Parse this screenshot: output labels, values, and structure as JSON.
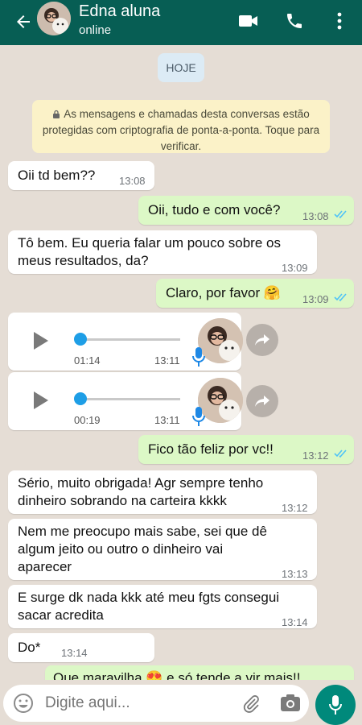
{
  "header": {
    "contact_name": "Edna aluna",
    "status": "online",
    "icons": [
      "back-arrow-icon",
      "avatar",
      "video-call-icon",
      "phone-icon",
      "menu-dots-icon"
    ]
  },
  "chat": {
    "date_chip": "HOJE",
    "security_notice": "As mensagens e chamadas desta conversas estão protegidas com criptografia de ponta-a-ponta. Toque para verificar.",
    "messages": [
      {
        "direction": "in",
        "text": "Oii td bem??",
        "time": "13:08"
      },
      {
        "direction": "out",
        "text": "Oii, tudo e com você?",
        "time": "13:08",
        "read": true
      },
      {
        "direction": "in",
        "text": "Tô bem. Eu queria falar um pouco sobre os meus resultados, da?",
        "time": "13:09"
      },
      {
        "direction": "out",
        "text": "Claro, por favor 🤗",
        "time": "13:09",
        "read": true
      },
      {
        "direction": "in",
        "type": "audio",
        "duration": "01:14",
        "time": "13:11"
      },
      {
        "direction": "in",
        "type": "audio",
        "duration": "00:19",
        "time": "13:11"
      },
      {
        "direction": "out",
        "text": "Fico tão feliz por vc!!",
        "time": "13:12",
        "read": true
      },
      {
        "direction": "in",
        "text": "Sério, muito obrigada! Agr sempre tenho dinheiro sobrando na carteira kkkk",
        "time": "13:12"
      },
      {
        "direction": "in",
        "text": "Nem me preocupo mais sabe, sei que dê algum jeito ou outro o dinheiro vai aparecer",
        "time": "13:13"
      },
      {
        "direction": "in",
        "text": "E surge dk nada kkk até meu fgts consegui sacar acredita",
        "time": "13:14"
      },
      {
        "direction": "in",
        "text": "Do*",
        "time": "13:14"
      },
      {
        "direction": "out",
        "text": "Que maravilha 😍 e só tende a vir mais!!",
        "time": ""
      }
    ]
  },
  "composer": {
    "placeholder": "Digite aqui..."
  },
  "colors": {
    "header": "#075e54",
    "chat_bg": "#e5ddd5",
    "outgoing_bubble": "#dcf8c6",
    "incoming_bubble": "#ffffff",
    "read_ticks": "#4fc3f7",
    "mic_button": "#00897b"
  }
}
